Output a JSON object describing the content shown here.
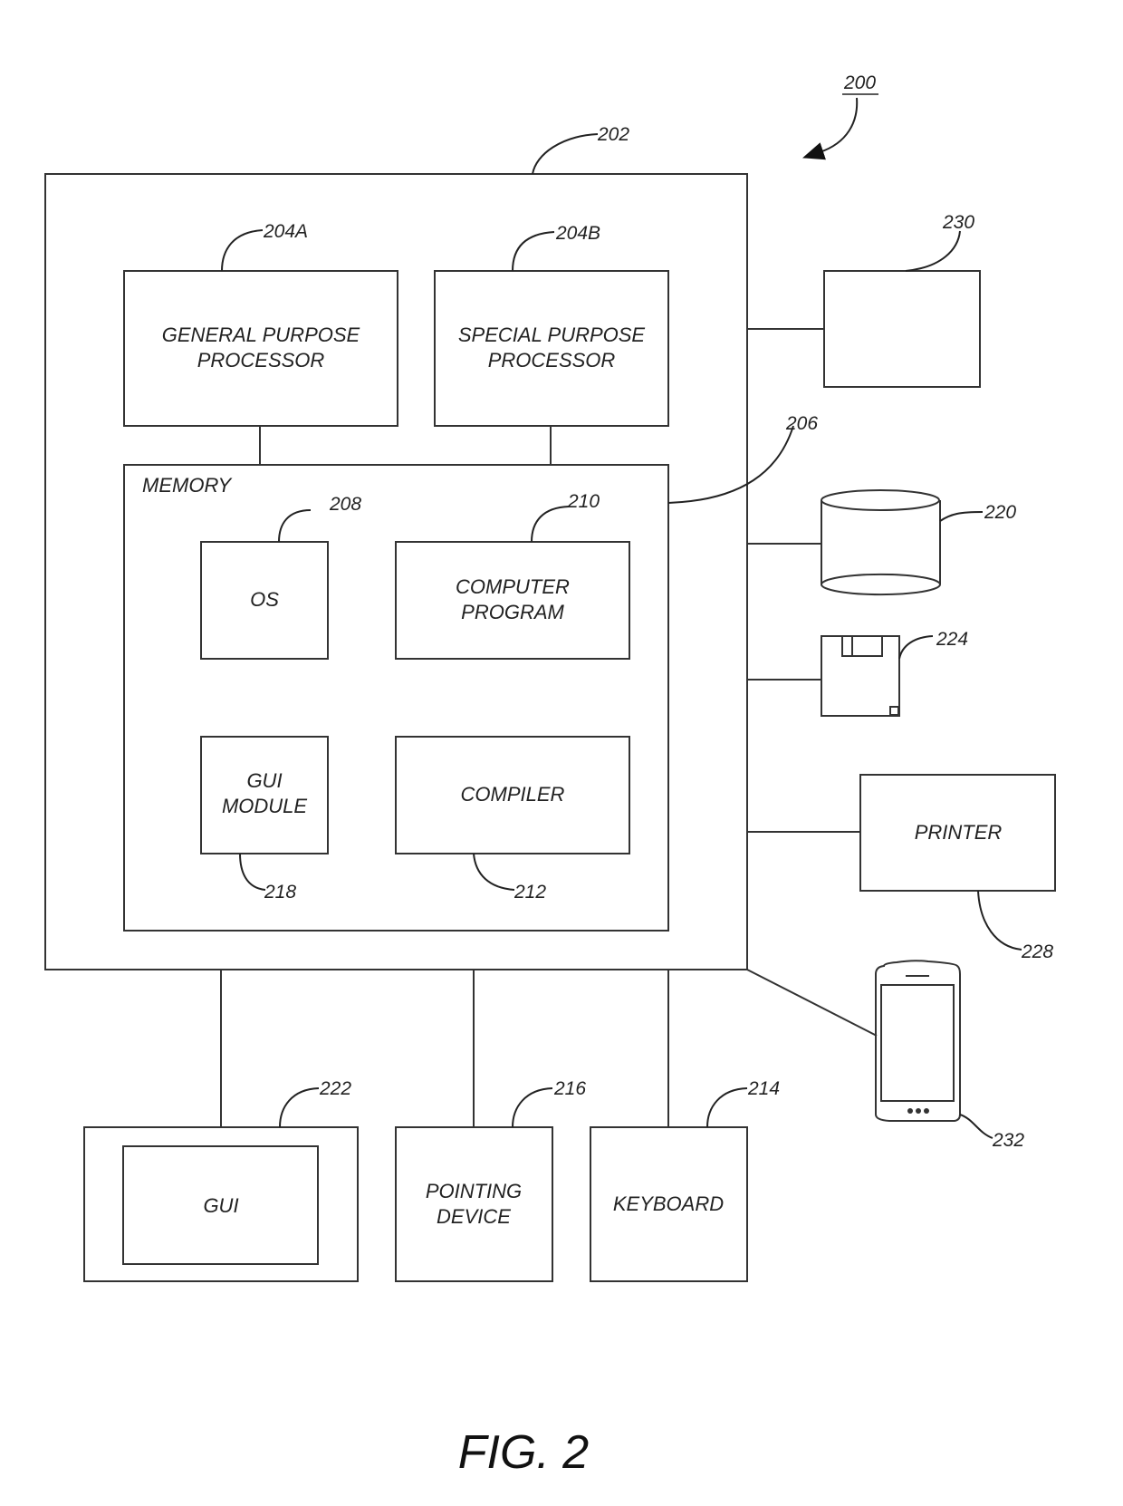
{
  "figure": {
    "caption": "FIG. 2",
    "system_ref": "200"
  },
  "computer": {
    "ref": "202",
    "general_processor": {
      "ref": "204A",
      "line1": "GENERAL PURPOSE",
      "line2": "PROCESSOR"
    },
    "special_processor": {
      "ref": "204B",
      "line1": "SPECIAL PURPOSE",
      "line2": "PROCESSOR"
    },
    "memory": {
      "ref": "206",
      "label": "MEMORY",
      "os": {
        "ref": "208",
        "label": "OS"
      },
      "program": {
        "ref": "210",
        "line1": "COMPUTER",
        "line2": "PROGRAM"
      },
      "gui_module": {
        "ref": "218",
        "line1": "GUI",
        "line2": "MODULE"
      },
      "compiler": {
        "ref": "212",
        "label": "COMPILER"
      }
    }
  },
  "peripherals": {
    "device_230": {
      "ref": "230"
    },
    "storage": {
      "ref": "220",
      "icon": "database-cylinder-icon"
    },
    "floppy": {
      "ref": "224",
      "icon": "floppy-disk-icon"
    },
    "printer": {
      "ref": "228",
      "label": "PRINTER"
    },
    "mobile": {
      "ref": "232",
      "icon": "smartphone-icon"
    },
    "display": {
      "ref": "222",
      "label": "GUI"
    },
    "pointing": {
      "ref": "216",
      "line1": "POINTING",
      "line2": "DEVICE"
    },
    "keyboard": {
      "ref": "214",
      "label": "KEYBOARD"
    }
  }
}
